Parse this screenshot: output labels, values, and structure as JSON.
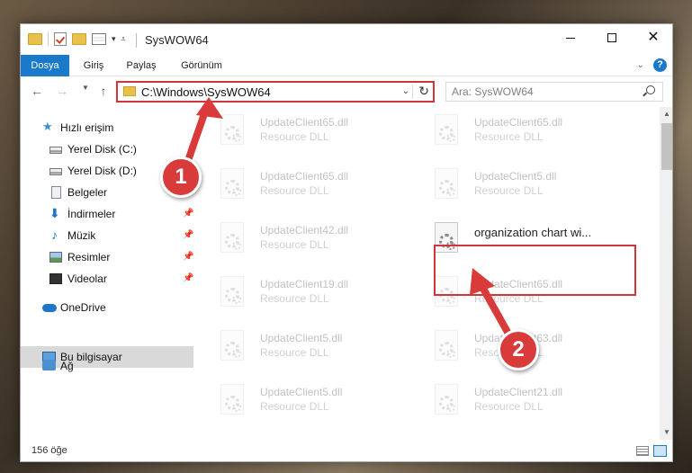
{
  "window": {
    "title": "SysWOW64"
  },
  "ribbon": {
    "tabs": [
      "Dosya",
      "Giriş",
      "Paylaş",
      "Görünüm"
    ],
    "help": "?"
  },
  "address": {
    "path": "C:\\Windows\\SysWOW64"
  },
  "search": {
    "placeholder": "Ara: SysWOW64"
  },
  "sidebar": {
    "items": [
      {
        "label": "Hızlı erişim",
        "icon": "star-icon"
      },
      {
        "label": "Yerel Disk (C:)",
        "icon": "drive-icon"
      },
      {
        "label": "Yerel Disk (D:)",
        "icon": "drive-icon"
      },
      {
        "label": "Belgeler",
        "icon": "documents-icon"
      },
      {
        "label": "İndirmeler",
        "icon": "download-icon"
      },
      {
        "label": "Müzik",
        "icon": "music-icon"
      },
      {
        "label": "Resimler",
        "icon": "pictures-icon"
      },
      {
        "label": "Videolar",
        "icon": "video-icon"
      },
      {
        "label": "OneDrive",
        "icon": "cloud-icon"
      },
      {
        "label": "Bu bilgisayar",
        "icon": "computer-icon"
      },
      {
        "label": "Ağ",
        "icon": "network-icon"
      }
    ]
  },
  "files": [
    {
      "name": "UpdateClient65.dll",
      "type": "Resource DLL"
    },
    {
      "name": "UpdateClient65.dll",
      "type": "Resource DLL"
    },
    {
      "name": "UpdateClient65.dll",
      "type": "Resource DLL"
    },
    {
      "name": "UpdateClient5.dll",
      "type": "Resource DLL"
    },
    {
      "name": "UpdateClient42.dll",
      "type": "Resource DLL"
    },
    {
      "name": "organization chart wi...",
      "type": ""
    },
    {
      "name": "UpdateClient19.dll",
      "type": "Resource DLL"
    },
    {
      "name": "UpdateClient65.dll",
      "type": "Resource DLL"
    },
    {
      "name": "UpdateClient5.dll",
      "type": "Resource DLL"
    },
    {
      "name": "UpdateClient63.dll",
      "type": "Resource DLL"
    },
    {
      "name": "UpdateClient5.dll",
      "type": "Resource DLL"
    },
    {
      "name": "UpdateClient21.dll",
      "type": "Resource DLL"
    }
  ],
  "status": {
    "count": "156 öğe"
  },
  "callouts": {
    "one": "1",
    "two": "2"
  },
  "colors": {
    "accent": "#1979ca",
    "highlight": "#d0353b"
  }
}
